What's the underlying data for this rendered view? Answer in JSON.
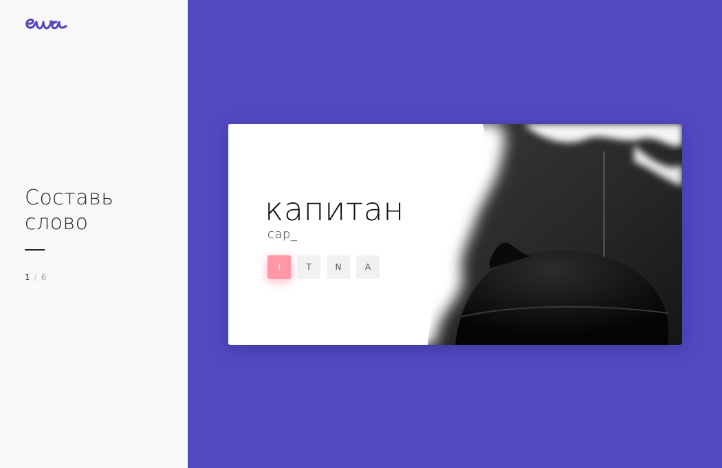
{
  "app": {
    "logo_text": "ewa",
    "logo_icon": "ewa-logo",
    "brand_color": "#5249c1",
    "accent_color": "#ff97a4"
  },
  "sidebar": {
    "title": "Составь слово",
    "progress": {
      "current": "1",
      "separator": "/",
      "total": "6"
    }
  },
  "exercise": {
    "word": "капитан",
    "answer_progress": "cap_",
    "letters": [
      {
        "label": "I",
        "state": "active"
      },
      {
        "label": "T",
        "state": "default"
      },
      {
        "label": "N",
        "state": "default"
      },
      {
        "label": "A",
        "state": "default"
      }
    ]
  }
}
